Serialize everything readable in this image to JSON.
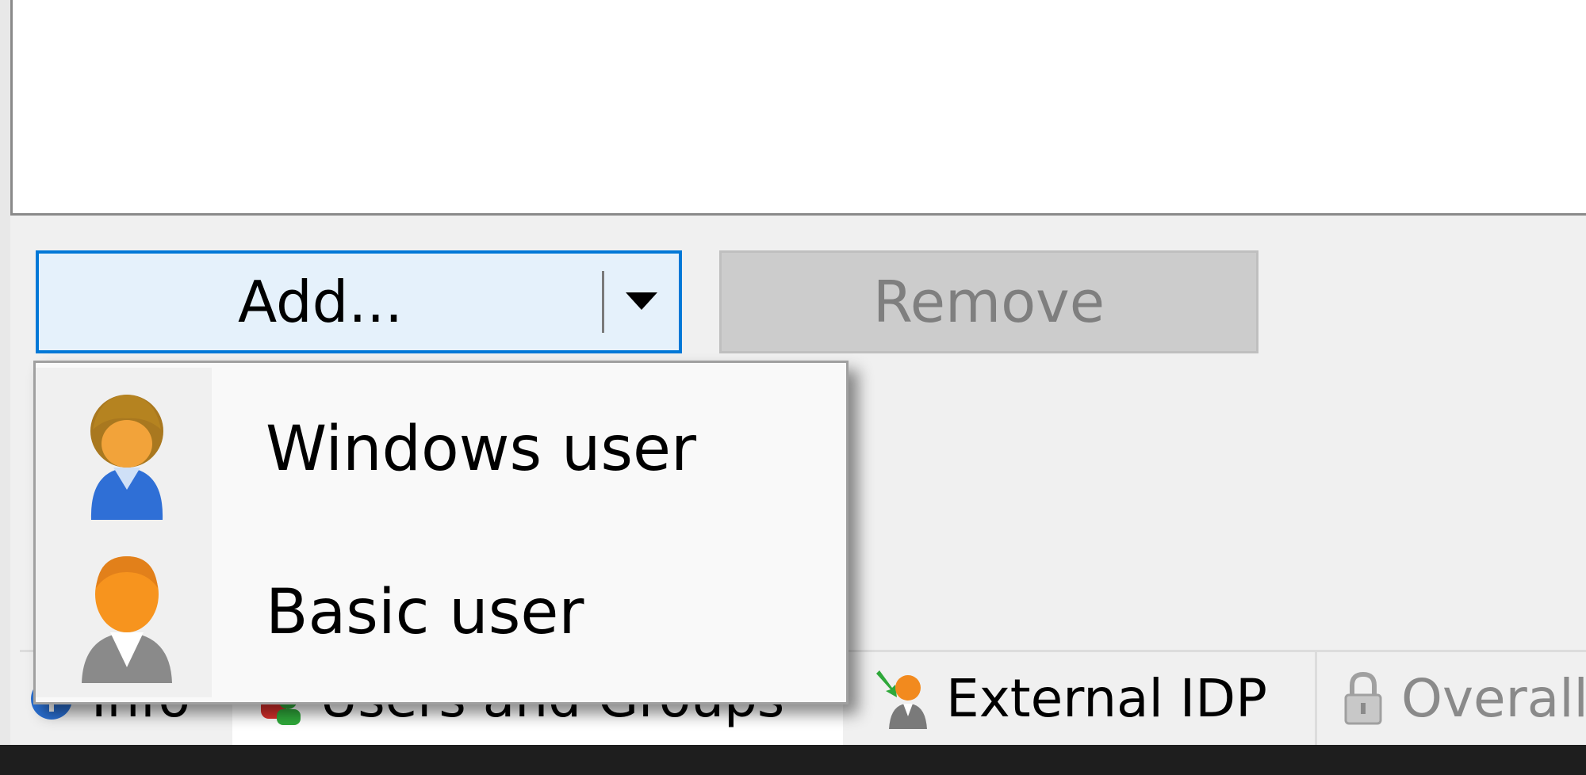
{
  "buttons": {
    "add_label": "Add...",
    "remove_label": "Remove"
  },
  "add_menu": {
    "items": [
      {
        "label": "Windows user",
        "icon": "windows-user-icon"
      },
      {
        "label": "Basic user",
        "icon": "basic-user-icon"
      }
    ]
  },
  "tabs": [
    {
      "label": "Info",
      "icon": "info-icon"
    },
    {
      "label": "Users and Groups",
      "icon": "users-groups-icon"
    },
    {
      "label": "External IDP",
      "icon": "external-idp-icon"
    },
    {
      "label": "Overall",
      "icon": "lock-icon"
    }
  ],
  "colors": {
    "accent": "#0078d7",
    "add_button_bg": "#e5f1fb",
    "disabled_button_bg": "#cccccc"
  }
}
